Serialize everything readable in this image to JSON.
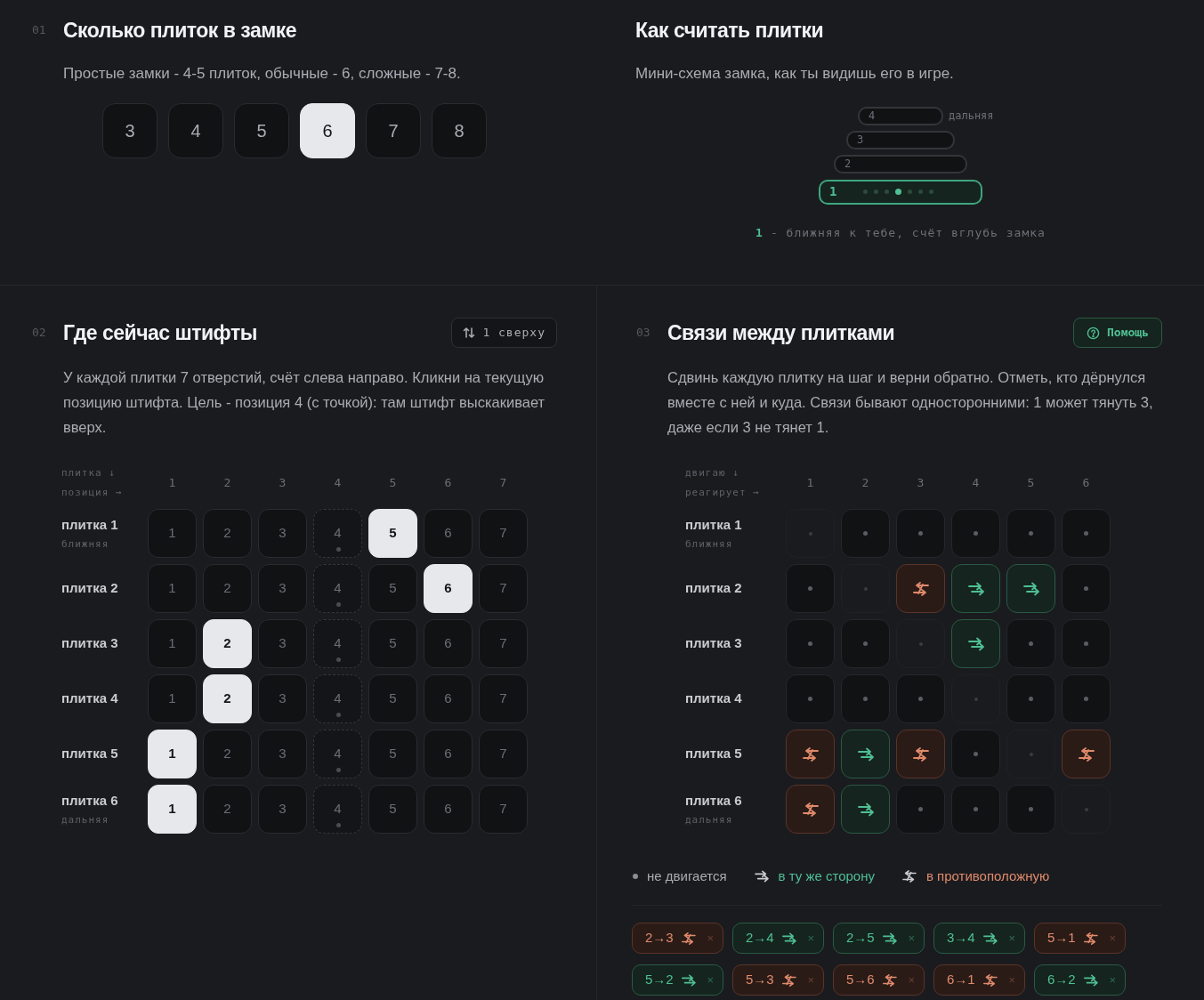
{
  "count_panel": {
    "number": "01",
    "title": "Сколько плиток в замке",
    "description": "Простые замки - 4-5 плиток, обычные - 6, сложные - 7-8.",
    "options": [
      {
        "label": "3",
        "selected": false
      },
      {
        "label": "4",
        "selected": false
      },
      {
        "label": "5",
        "selected": false
      },
      {
        "label": "6",
        "selected": true
      },
      {
        "label": "7",
        "selected": false
      },
      {
        "label": "8",
        "selected": false
      }
    ]
  },
  "howto_panel": {
    "title": "Как считать плитки",
    "description": "Мини-схема замка, как ты видишь его в игре.",
    "tiers": [
      {
        "label": "4",
        "note": "дальняя",
        "highlighted": false
      },
      {
        "label": "3",
        "highlighted": false
      },
      {
        "label": "2",
        "highlighted": false
      },
      {
        "label": "1",
        "highlighted": true,
        "pins": [
          false,
          false,
          false,
          true,
          false,
          false,
          false
        ]
      }
    ],
    "caption_marker": "1",
    "caption": "- ближняя к тебе, счёт вглубь замка"
  },
  "pins_panel": {
    "number": "02",
    "title": "Где сейчас штифты",
    "order_button": "1 сверху",
    "description": "У каждой плитки 7 отверстий, счёт слева направо. Кликни на текущую позицию штифта. Цель - позиция 4 (с точкой): там штифт выскакивает вверх.",
    "row_axis": "плитка ↓",
    "column_axis": "позиция →",
    "columns": [
      "1",
      "2",
      "3",
      "4",
      "5",
      "6",
      "7"
    ],
    "rows": [
      {
        "label": "плитка 1",
        "sublabel": "ближняя",
        "cells": [
          {
            "label": "1",
            "selected": false,
            "target": false
          },
          {
            "label": "2",
            "selected": false,
            "target": false
          },
          {
            "label": "3",
            "selected": false,
            "target": false
          },
          {
            "label": "4",
            "selected": false,
            "target": true
          },
          {
            "label": "5",
            "selected": true,
            "target": false
          },
          {
            "label": "6",
            "selected": false,
            "target": false
          },
          {
            "label": "7",
            "selected": false,
            "target": false
          }
        ]
      },
      {
        "label": "плитка 2",
        "cells": [
          {
            "label": "1",
            "selected": false,
            "target": false
          },
          {
            "label": "2",
            "selected": false,
            "target": false
          },
          {
            "label": "3",
            "selected": false,
            "target": false
          },
          {
            "label": "4",
            "selected": false,
            "target": true
          },
          {
            "label": "5",
            "selected": false,
            "target": false
          },
          {
            "label": "6",
            "selected": true,
            "target": false
          },
          {
            "label": "7",
            "selected": false,
            "target": false
          }
        ]
      },
      {
        "label": "плитка 3",
        "cells": [
          {
            "label": "1",
            "selected": false,
            "target": false
          },
          {
            "label": "2",
            "selected": true,
            "target": false
          },
          {
            "label": "3",
            "selected": false,
            "target": false
          },
          {
            "label": "4",
            "selected": false,
            "target": true
          },
          {
            "label": "5",
            "selected": false,
            "target": false
          },
          {
            "label": "6",
            "selected": false,
            "target": false
          },
          {
            "label": "7",
            "selected": false,
            "target": false
          }
        ]
      },
      {
        "label": "плитка 4",
        "cells": [
          {
            "label": "1",
            "selected": false,
            "target": false
          },
          {
            "label": "2",
            "selected": true,
            "target": false
          },
          {
            "label": "3",
            "selected": false,
            "target": false
          },
          {
            "label": "4",
            "selected": false,
            "target": true
          },
          {
            "label": "5",
            "selected": false,
            "target": false
          },
          {
            "label": "6",
            "selected": false,
            "target": false
          },
          {
            "label": "7",
            "selected": false,
            "target": false
          }
        ]
      },
      {
        "label": "плитка 5",
        "cells": [
          {
            "label": "1",
            "selected": true,
            "target": false
          },
          {
            "label": "2",
            "selected": false,
            "target": false
          },
          {
            "label": "3",
            "selected": false,
            "target": false
          },
          {
            "label": "4",
            "selected": false,
            "target": true
          },
          {
            "label": "5",
            "selected": false,
            "target": false
          },
          {
            "label": "6",
            "selected": false,
            "target": false
          },
          {
            "label": "7",
            "selected": false,
            "target": false
          }
        ]
      },
      {
        "label": "плитка 6",
        "sublabel": "дальняя",
        "cells": [
          {
            "label": "1",
            "selected": true,
            "target": false
          },
          {
            "label": "2",
            "selected": false,
            "target": false
          },
          {
            "label": "3",
            "selected": false,
            "target": false
          },
          {
            "label": "4",
            "selected": false,
            "target": true
          },
          {
            "label": "5",
            "selected": false,
            "target": false
          },
          {
            "label": "6",
            "selected": false,
            "target": false
          },
          {
            "label": "7",
            "selected": false,
            "target": false
          }
        ]
      }
    ]
  },
  "links_panel": {
    "number": "03",
    "title": "Связи между плитками",
    "help_button": "Помощь",
    "description": "Сдвинь каждую плитку на шаг и верни обратно. Отметь, кто дёрнулся вместе с ней и куда. Связи бывают односторонними: 1 может тянуть 3, даже если 3 не тянет 1.",
    "row_axis": "двигаю ↓",
    "column_axis": "реагирует →",
    "columns": [
      "1",
      "2",
      "3",
      "4",
      "5",
      "6"
    ],
    "rows": [
      {
        "label": "плитка 1",
        "sublabel": "ближняя",
        "cells": [
          {
            "kind": "self"
          },
          {
            "kind": "none"
          },
          {
            "kind": "none"
          },
          {
            "kind": "none"
          },
          {
            "kind": "none"
          },
          {
            "kind": "none"
          }
        ]
      },
      {
        "label": "плитка 2",
        "cells": [
          {
            "kind": "none"
          },
          {
            "kind": "self"
          },
          {
            "kind": "opposite"
          },
          {
            "kind": "same"
          },
          {
            "kind": "same"
          },
          {
            "kind": "none"
          }
        ]
      },
      {
        "label": "плитка 3",
        "cells": [
          {
            "kind": "none"
          },
          {
            "kind": "none"
          },
          {
            "kind": "self"
          },
          {
            "kind": "same"
          },
          {
            "kind": "none"
          },
          {
            "kind": "none"
          }
        ]
      },
      {
        "label": "плитка 4",
        "cells": [
          {
            "kind": "none"
          },
          {
            "kind": "none"
          },
          {
            "kind": "none"
          },
          {
            "kind": "self"
          },
          {
            "kind": "none"
          },
          {
            "kind": "none"
          }
        ]
      },
      {
        "label": "плитка 5",
        "cells": [
          {
            "kind": "opposite"
          },
          {
            "kind": "same"
          },
          {
            "kind": "opposite"
          },
          {
            "kind": "none"
          },
          {
            "kind": "self"
          },
          {
            "kind": "opposite"
          }
        ]
      },
      {
        "label": "плитка 6",
        "sublabel": "дальняя",
        "cells": [
          {
            "kind": "opposite"
          },
          {
            "kind": "same"
          },
          {
            "kind": "none"
          },
          {
            "kind": "none"
          },
          {
            "kind": "none"
          },
          {
            "kind": "self"
          }
        ]
      }
    ],
    "legend": [
      {
        "kind": "none",
        "label": "не двигается"
      },
      {
        "kind": "same",
        "label": "в ту же сторону"
      },
      {
        "kind": "opposite",
        "label": "в противоположную"
      }
    ],
    "links": [
      {
        "label": "2→3",
        "kind": "opposite",
        "remove": "×"
      },
      {
        "label": "2→4",
        "kind": "same",
        "remove": "×"
      },
      {
        "label": "2→5",
        "kind": "same",
        "remove": "×"
      },
      {
        "label": "3→4",
        "kind": "same",
        "remove": "×"
      },
      {
        "label": "5→1",
        "kind": "opposite",
        "remove": "×"
      },
      {
        "label": "5→2",
        "kind": "same",
        "remove": "×"
      },
      {
        "label": "5→3",
        "kind": "opposite",
        "remove": "×"
      },
      {
        "label": "5→6",
        "kind": "opposite",
        "remove": "×"
      },
      {
        "label": "6→1",
        "kind": "opposite",
        "remove": "×"
      },
      {
        "label": "6→2",
        "kind": "same",
        "remove": "×"
      }
    ]
  }
}
